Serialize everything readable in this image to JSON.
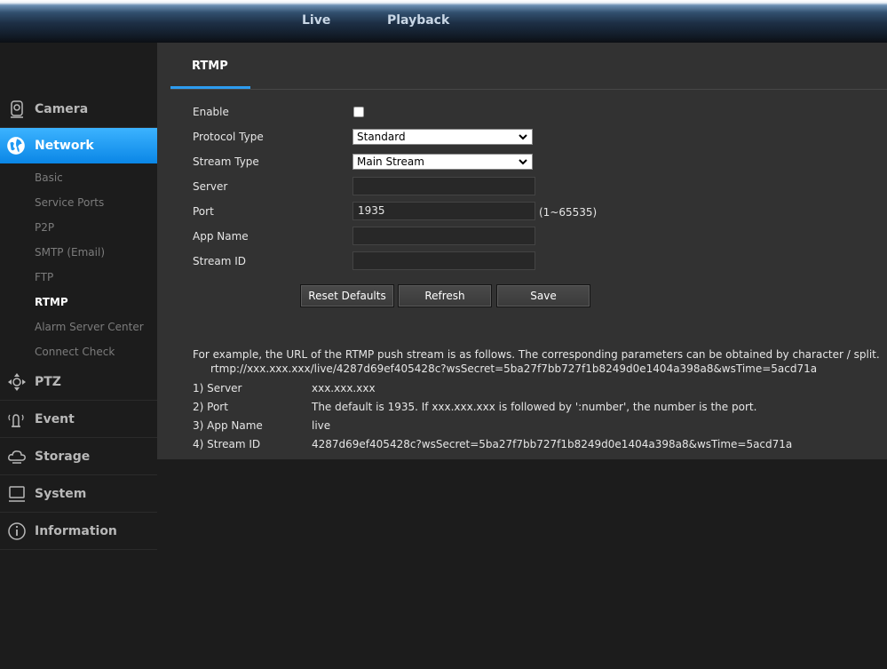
{
  "topnav": {
    "live": "Live",
    "playback": "Playback"
  },
  "sidebar": {
    "camera": "Camera",
    "network": "Network",
    "network_sub": [
      "Basic",
      "Service Ports",
      "P2P",
      "SMTP (Email)",
      "FTP",
      "RTMP",
      "Alarm Server Center",
      "Connect Check"
    ],
    "ptz": "PTZ",
    "event": "Event",
    "storage": "Storage",
    "system": "System",
    "information": "Information"
  },
  "tab": {
    "label": "RTMP"
  },
  "form": {
    "enable_label": "Enable",
    "enable_checked": false,
    "protocol_label": "Protocol Type",
    "protocol_value": "Standard",
    "stream_label": "Stream Type",
    "stream_value": "Main Stream",
    "server_label": "Server",
    "server_value": "",
    "port_label": "Port",
    "port_value": "1935",
    "port_range": "(1~65535)",
    "appname_label": "App Name",
    "appname_value": "",
    "streamid_label": "Stream ID",
    "streamid_value": ""
  },
  "buttons": {
    "reset": "Reset Defaults",
    "refresh": "Refresh",
    "save": "Save"
  },
  "notes": {
    "intro": "For example, the URL of the RTMP push stream is as follows. The corresponding parameters can be obtained by character / split.",
    "url": "rtmp://xxx.xxx.xxx/live/4287d69ef405428c?wsSecret=5ba27f7bb727f1b8249d0e1404a398a8&wsTime=5acd71a",
    "rows": [
      {
        "key": "1) Server",
        "val": "xxx.xxx.xxx"
      },
      {
        "key": "2) Port",
        "val": "The default is 1935. If xxx.xxx.xxx is followed by ':number', the number is the port."
      },
      {
        "key": "3) App Name",
        "val": "live"
      },
      {
        "key": "4) Stream ID",
        "val": "4287d69ef405428c?wsSecret=5ba27f7bb727f1b8249d0e1404a398a8&wsTime=5acd71a"
      }
    ]
  },
  "colors": {
    "accent": "#1f9af4",
    "content_bg": "#323232",
    "page_bg": "#1c1c1c"
  }
}
